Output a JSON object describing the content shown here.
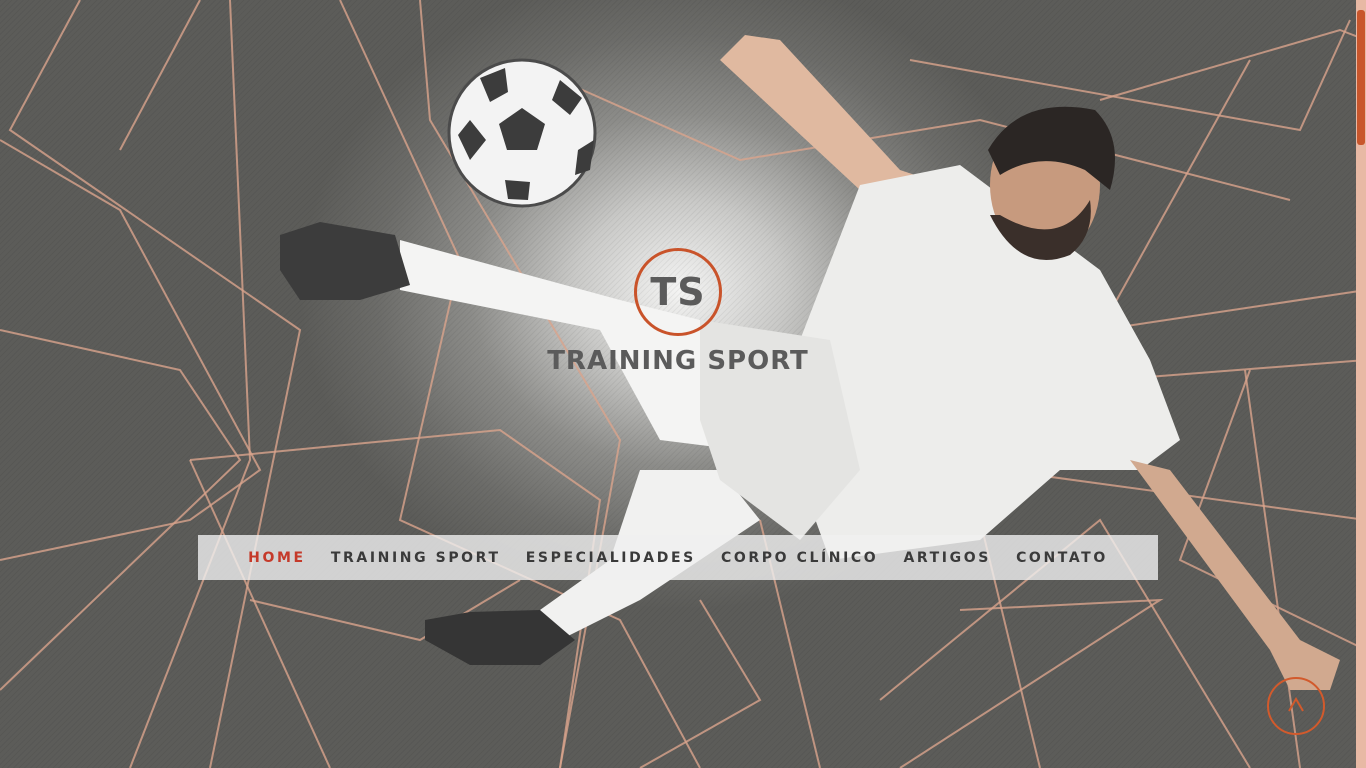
{
  "brand": {
    "initials": "TS",
    "name": "TRAINING SPORT",
    "accent_color": "#c9532a"
  },
  "nav": {
    "items": [
      {
        "label": "HOME",
        "active": true
      },
      {
        "label": "TRAINING SPORT",
        "active": false
      },
      {
        "label": "ESPECIALIDADES",
        "active": false
      },
      {
        "label": "CORPO CLÍNICO",
        "active": false
      },
      {
        "label": "ARTIGOS",
        "active": false
      },
      {
        "label": "CONTATO",
        "active": false
      }
    ]
  },
  "scroll_top_icon": "chevron-up-icon",
  "hero_image": "soccer-player-bicycle-kick"
}
